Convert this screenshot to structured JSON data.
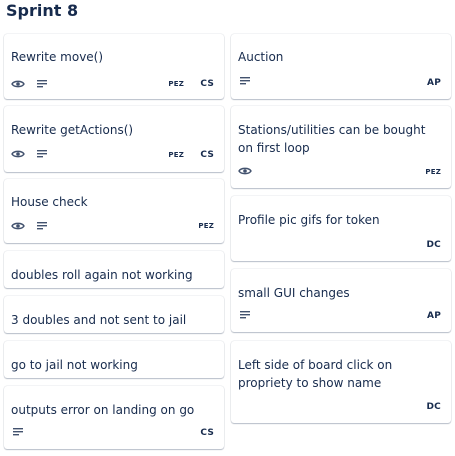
{
  "list": {
    "title": "Sprint 8"
  },
  "left_cards": [
    {
      "title": "Rewrite move()",
      "watch": true,
      "description": true,
      "members": [
        "PEZ",
        "CS"
      ]
    },
    {
      "title": "Rewrite getActions()",
      "watch": true,
      "description": true,
      "members": [
        "PEZ",
        "CS"
      ]
    },
    {
      "title": "House check",
      "watch": true,
      "description": true,
      "members": [
        "PEZ"
      ]
    },
    {
      "title": "doubles roll again not working"
    },
    {
      "title": "3 doubles and not sent to jail"
    },
    {
      "title": "go to jail not working"
    },
    {
      "title": "outputs error on landing on go",
      "description": true,
      "members": [
        "CS"
      ]
    }
  ],
  "right_cards": [
    {
      "title": "Auction",
      "description": true,
      "members": [
        "AP"
      ]
    },
    {
      "title": "Stations/utilities can be bought on first loop",
      "watch": true,
      "members": [
        "PEZ"
      ]
    },
    {
      "title": "Profile pic gifs for token",
      "members": [
        "DC"
      ]
    },
    {
      "title": "small GUI changes",
      "description": true,
      "members": [
        "AP"
      ]
    },
    {
      "title": "Left side of board click on propriety to show name",
      "members": [
        "DC"
      ]
    }
  ],
  "icons": {
    "watch": "eye-icon",
    "description": "description-lines-icon"
  }
}
